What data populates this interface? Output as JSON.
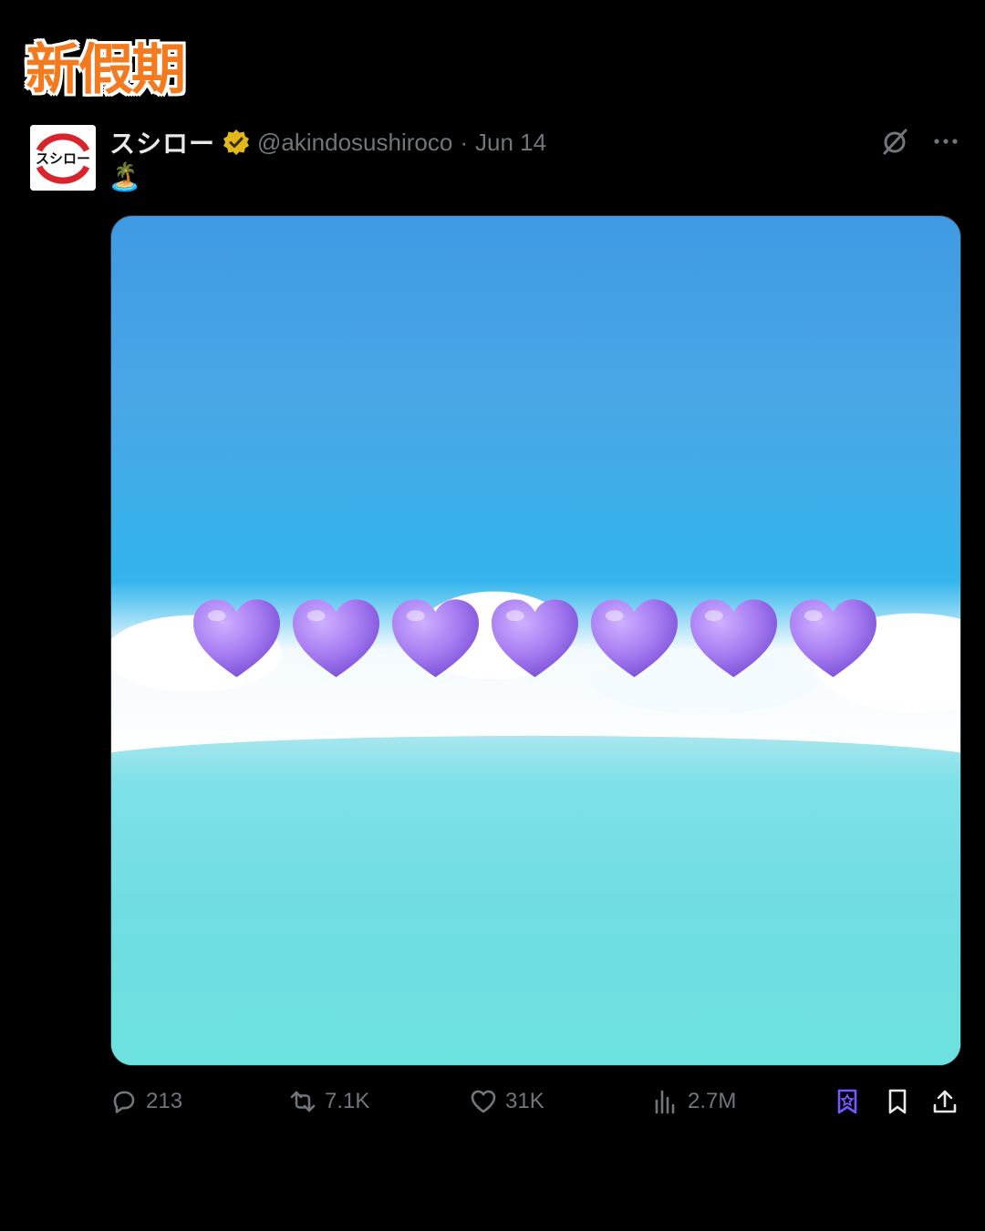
{
  "watermark": {
    "text": "新假期",
    "color": "#f47a1f"
  },
  "tweet": {
    "avatar_text": "スシロー",
    "display_name": "スシロー",
    "verified": "gold-verified-badge",
    "handle": "@akindosushiroco",
    "separator": "·",
    "date": "Jun 14",
    "text": "🏝️",
    "media": {
      "hearts": [
        "💜",
        "💜",
        "💜",
        "💜",
        "💜",
        "💜",
        "💜"
      ]
    }
  },
  "actions": {
    "replies": "213",
    "reposts": "7.1K",
    "likes": "31K",
    "views": "2.7M"
  },
  "colors": {
    "background": "#000000",
    "muted": "#71767b",
    "accent_grok": "#7856ff",
    "heart": "#a77cf2"
  }
}
